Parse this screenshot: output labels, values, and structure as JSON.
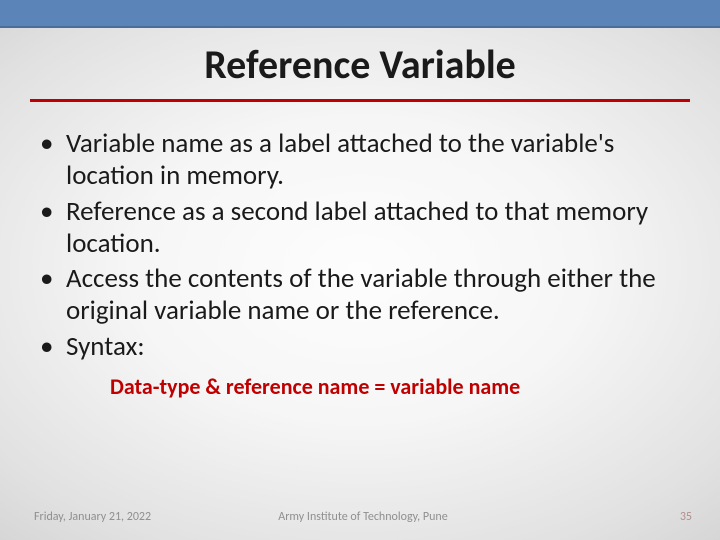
{
  "title": "Reference Variable",
  "bullets": [
    "Variable name as a label attached to the variable's location in memory.",
    "Reference as a second label attached to that memory location.",
    "Access the contents of the variable through either the original variable name or the reference.",
    "Syntax:"
  ],
  "syntax_line": "Data-type & reference name = variable name",
  "footer": {
    "date": "Friday, January 21, 2022",
    "org": "Army Institute of Technology, Pune",
    "page": "35"
  },
  "colors": {
    "accent_bar": "#5b85b8",
    "underline": "#c00000",
    "syntax_text": "#c00000"
  }
}
